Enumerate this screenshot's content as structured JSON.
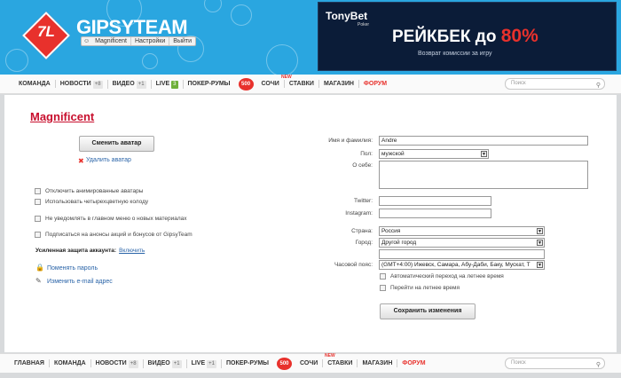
{
  "header": {
    "logo_mark": "7L",
    "logo_text": "GIPSYTEAM",
    "userbar": [
      "Magnificent",
      "Настройки",
      "Выйти"
    ]
  },
  "banner": {
    "brand": "TonyBet",
    "brand_sub": "Poker",
    "main": "РЕЙКБЕК до ",
    "pct": "80%",
    "sub": "Возврат комиссии за игру"
  },
  "nav": {
    "items": [
      {
        "label": "КОМАНДА"
      },
      {
        "label": "НОВОСТИ",
        "badge": "+8"
      },
      {
        "label": "ВИДЕО",
        "badge": "+1"
      },
      {
        "label": "LIVE",
        "badge": "3"
      },
      {
        "label": "ПОКЕР-РУМЫ"
      },
      {
        "label": "СОЧИ"
      },
      {
        "label": "СТАВКИ"
      },
      {
        "label": "МАГАЗИН"
      },
      {
        "label": "ФОРУМ"
      }
    ],
    "badge_500": "500",
    "new_label": "NEW",
    "search_placeholder": "Поиск"
  },
  "footer_nav": {
    "items": [
      {
        "label": "ГЛАВНАЯ"
      },
      {
        "label": "КОМАНДА"
      },
      {
        "label": "НОВОСТИ",
        "badge": "+8"
      },
      {
        "label": "ВИДЕО",
        "badge": "+1"
      },
      {
        "label": "LIVE",
        "badge": "+1"
      },
      {
        "label": "ПОКЕР-РУМЫ"
      },
      {
        "label": "СОЧИ"
      },
      {
        "label": "СТАВКИ"
      },
      {
        "label": "МАГАЗИН"
      },
      {
        "label": "ФОРУМ"
      }
    ],
    "badge_500": "500",
    "new_label": "NEW",
    "search_placeholder": "Поиск"
  },
  "profile": {
    "title": "Magnificent",
    "change_avatar": "Сменить аватар",
    "delete_avatar": "Удалить аватар",
    "options": [
      "Отключить анимированные аватары",
      "Использовать четырехцветную колоду",
      "Не уведомлять в главном меню о новых материалах",
      "Подписаться на анонсы акций и бонусов от GipsyTeam"
    ],
    "security_label": "Усиленная защита аккаунта:",
    "security_link": "Включить",
    "change_password": "Поменять пароль",
    "change_email": "Изменить e-mail адрес"
  },
  "form": {
    "name_label": "Имя и фамилия:",
    "name_value": "Andre",
    "gender_label": "Пол:",
    "gender_value": "мужской",
    "about_label": "О себе:",
    "twitter_label": "Twitter:",
    "instagram_label": "Instagram:",
    "country_label": "Страна:",
    "country_value": "Россия",
    "city_label": "Город:",
    "city_value": "Другой город",
    "tz_label": "Часовой пояс:",
    "tz_value": "(GMT+4:00) Ижевск, Самара, Абу-Даби, Баку, Мускат, Т",
    "auto_dst": "Автоматический переход на летнее время",
    "manual_dst": "Перейти на летнее время",
    "save": "Сохранить изменения"
  },
  "colors": {
    "accent": "#e8312c",
    "header_bg": "#2aa6e0",
    "link": "#2a64a8"
  }
}
